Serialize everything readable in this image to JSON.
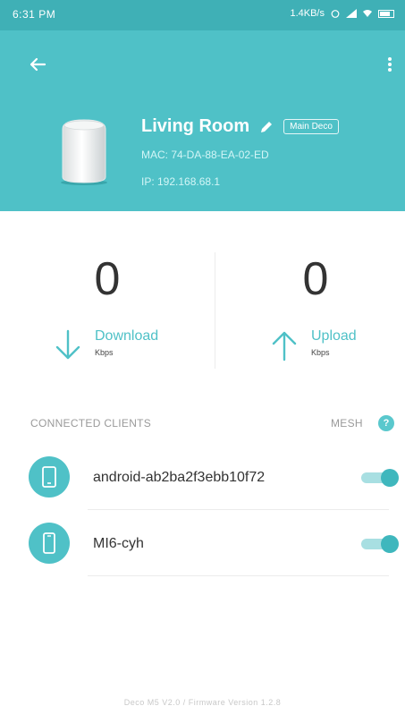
{
  "status_bar": {
    "time": "6:31 PM",
    "network_info": "1.4KB/s",
    "battery_icon": "battery-icon"
  },
  "header": {
    "device_name": "Living Room",
    "badge": "Main Deco",
    "mac": "MAC: 74-DA-88-EA-02-ED",
    "ip": "IP: 192.168.68.1"
  },
  "stats": {
    "download": {
      "value": "0",
      "label": "Download",
      "unit": "Kbps"
    },
    "upload": {
      "value": "0",
      "label": "Upload",
      "unit": "Kbps"
    }
  },
  "clients_section": {
    "title": "CONNECTED CLIENTS",
    "mesh_label": "MESH",
    "help_glyph": "?",
    "clients": [
      {
        "name": "android-ab2ba2f3ebb10f72",
        "mesh_enabled": true
      },
      {
        "name": "MI6-cyh",
        "mesh_enabled": true
      }
    ]
  },
  "footer": {
    "text": "Deco M5 V2.0 / Firmware Version 1.2.8"
  },
  "colors": {
    "accent": "#4fc1c7",
    "status_bar": "#3fb0b6",
    "text_primary": "#333333",
    "text_muted": "#9a9a9a"
  }
}
